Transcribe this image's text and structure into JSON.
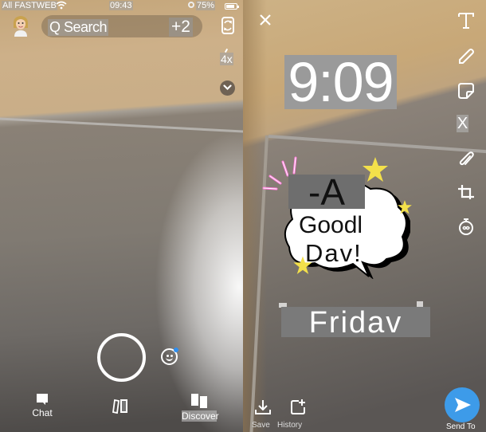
{
  "camera_screen": {
    "status_bar": {
      "carrier": "All FASTWEB",
      "time": "09:43",
      "battery_percent": "75%"
    },
    "search": {
      "label": "Q Search",
      "badge": "+2"
    },
    "zoom_level": "4x",
    "bottom_nav": {
      "chat_label": "Chat",
      "discover_label": "Discover"
    },
    "icons": [
      "bitmoji-avatar",
      "flip-camera-icon",
      "chevron-down-icon",
      "shutter-button",
      "lens-icon",
      "chat-icon",
      "memories-icon",
      "discover-icon"
    ],
    "accent_color": "#2f8ff0"
  },
  "editor_screen": {
    "toolbar": {
      "scissors_label": "X",
      "items": [
        "text-tool",
        "pen-tool",
        "sticker-tool",
        "scissors-tool",
        "paperclip-tool",
        "crop-tool",
        "timer-tool"
      ]
    },
    "stickers": {
      "time": "9:09",
      "a_label": "-A",
      "good_label": "Goodl",
      "day_label": "Dav!",
      "weekday": "Fridav"
    },
    "bottom": {
      "save_label": "Save",
      "history_label": "History",
      "send_label": "Send To"
    },
    "accent_color": "#3d9be9"
  }
}
